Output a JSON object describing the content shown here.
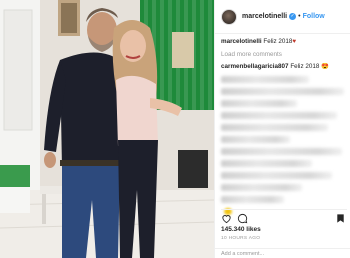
{
  "post": {
    "username": "marcelotinelli",
    "follow_label": "Follow",
    "separator": "•",
    "verified_mark": "✓",
    "caption_user": "marcelotinelli",
    "caption_text": "Feliz 2018",
    "caption_emoji": "♥",
    "load_more": "Load more comments",
    "first_comment_user": "carmenbellagaricia807",
    "first_comment_text": "Feliz 2018",
    "first_comment_emoji": "😍",
    "likes": "145.340 likes",
    "time_ago": "10 HOURS AGO",
    "add_comment_placeholder": "Add a comment..."
  },
  "icons": {
    "heart": "heart-icon",
    "comment": "comment-icon",
    "bookmark": "bookmark-icon",
    "verified": "verified-icon"
  },
  "colors": {
    "link_blue": "#3897f0",
    "heart_red": "#c0392b",
    "muted": "#999999",
    "text": "#262626"
  }
}
